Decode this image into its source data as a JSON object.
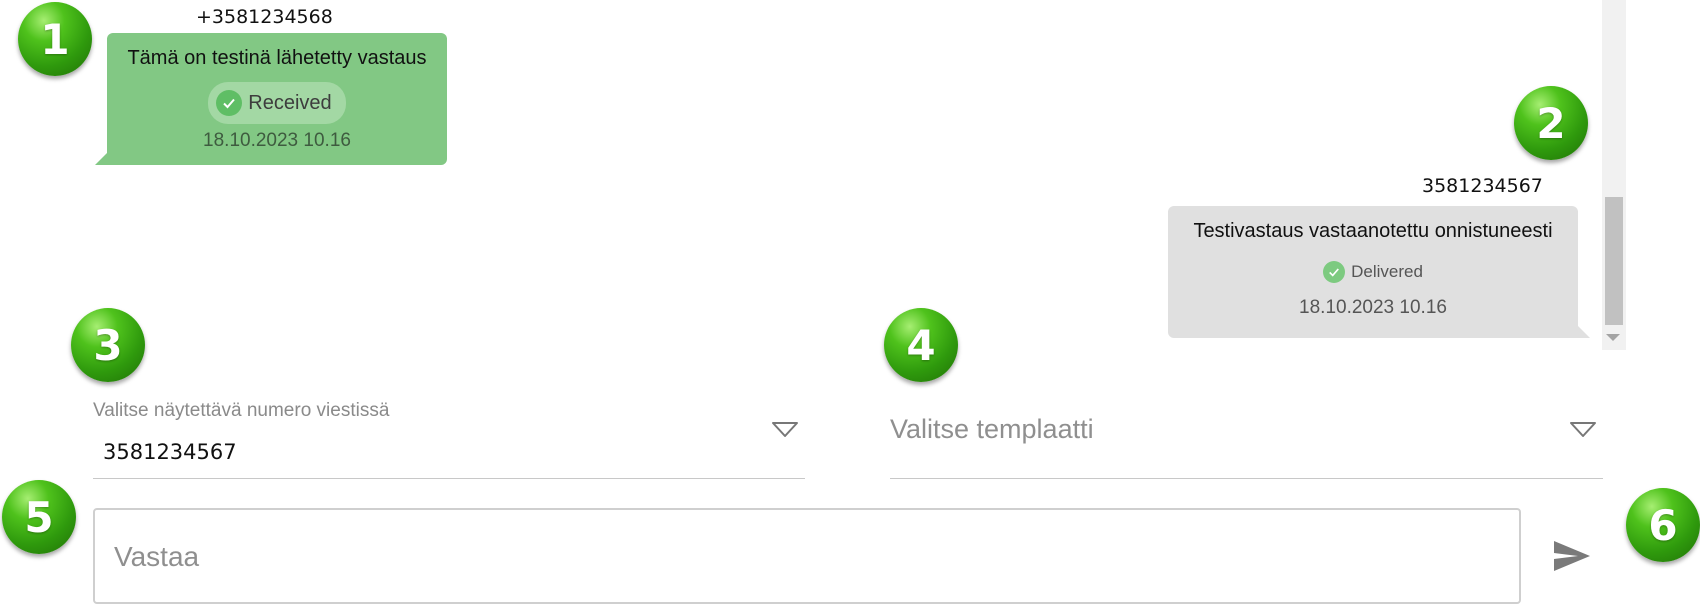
{
  "badges": [
    "1",
    "2",
    "3",
    "4",
    "5",
    "6"
  ],
  "messages": {
    "incoming": {
      "sender": "+3581234568",
      "text": "Tämä on testinä lähetetty vastaus",
      "status": "Received",
      "timestamp": "18.10.2023 10.16",
      "status_icon": "check-circle-icon",
      "bubble_color": "#82c884"
    },
    "outgoing": {
      "sender": "3581234567",
      "text": "Testivastaus vastaanotettu onnistuneesti",
      "status": "Delivered",
      "timestamp": "18.10.2023 10.16",
      "status_icon": "check-circle-icon",
      "bubble_color": "#e0e0e0"
    }
  },
  "number_select": {
    "label": "Valitse näytettävä numero viestissä",
    "value": "3581234567",
    "icon": "dropdown-arrow-icon"
  },
  "template_select": {
    "placeholder": "Valitse templaatti",
    "icon": "dropdown-arrow-icon"
  },
  "reply": {
    "placeholder": "Vastaa",
    "send_icon": "send-icon"
  },
  "colors": {
    "badge": "#3fae14",
    "incoming_bubble": "#82c884",
    "outgoing_bubble": "#e0e0e0"
  }
}
